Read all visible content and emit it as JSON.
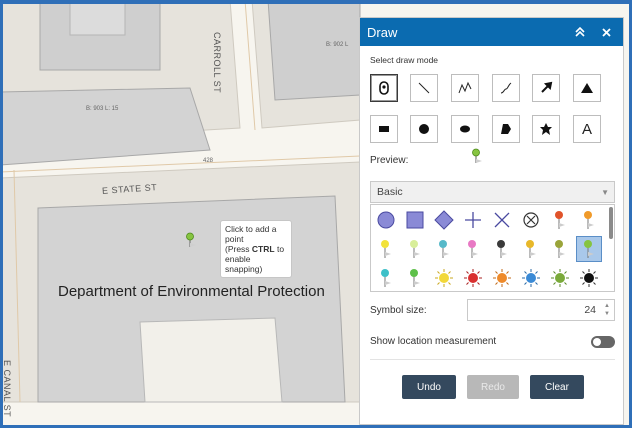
{
  "map": {
    "labels": {
      "block_903": "B: 903 L: 15",
      "block_902": "B: 902 L",
      "carroll_st": "CARROLL ST",
      "state_st": "E STATE ST",
      "canal_st": "E CANAL ST",
      "num_428": "428"
    },
    "building_label": "Department of Environmental Protection",
    "tooltip": {
      "line1": "Click to add a point",
      "line2_prefix": "(Press ",
      "line2_key": "CTRL",
      "line2_suffix": " to enable snapping)"
    }
  },
  "panel": {
    "title": "Draw",
    "collapse_icon": "double-chevron-up-icon",
    "close_icon": "close-icon",
    "select_mode_label": "Select draw mode",
    "tools": [
      {
        "name": "point",
        "icon": "point-pin-icon",
        "active": true
      },
      {
        "name": "line",
        "icon": "line-icon"
      },
      {
        "name": "polyline",
        "icon": "polyline-icon"
      },
      {
        "name": "freehand-polyline",
        "icon": "freehand-line-icon"
      },
      {
        "name": "arrow",
        "icon": "arrow-icon"
      },
      {
        "name": "triangle",
        "icon": "triangle-icon"
      },
      {
        "name": "rectangle",
        "icon": "rectangle-icon"
      },
      {
        "name": "circle",
        "icon": "circle-icon"
      },
      {
        "name": "ellipse",
        "icon": "ellipse-icon"
      },
      {
        "name": "polygon",
        "icon": "polygon-icon"
      },
      {
        "name": "freehand-polygon",
        "icon": "freehand-polygon-icon"
      },
      {
        "name": "text",
        "icon": "text-icon",
        "text": "A"
      }
    ],
    "preview_label": "Preview:",
    "symbol_set": "Basic",
    "symbol_size_label": "Symbol size:",
    "symbol_size": "24",
    "location_label": "Show location measurement",
    "buttons": {
      "undo": "Undo",
      "redo": "Redo",
      "clear": "Clear"
    }
  },
  "colors": {
    "header": "#0b6bb0",
    "frame": "#2f6fb8",
    "primary_button": "#34495e",
    "disabled_button": "#b8b8b8",
    "symbol_shape": "#8a8ad6",
    "selected_symbol": "#a9c8ea"
  }
}
